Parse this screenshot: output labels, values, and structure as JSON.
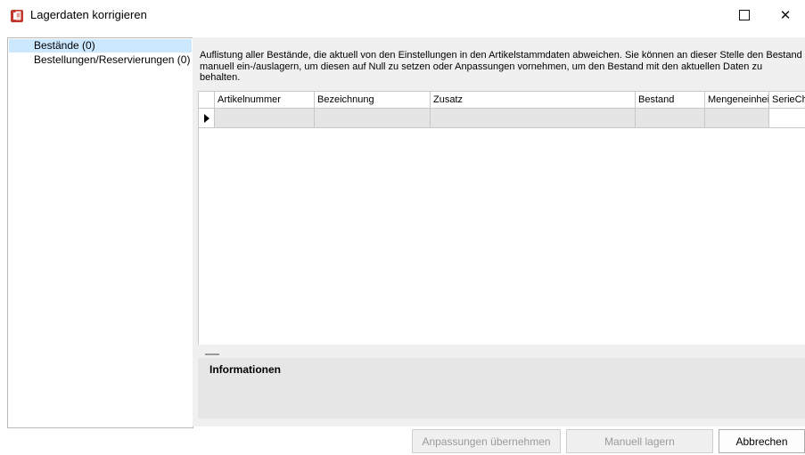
{
  "window": {
    "title": "Lagerdaten korrigieren"
  },
  "sidebar": {
    "items": [
      {
        "label": "Bestände (0)",
        "selected": true
      },
      {
        "label": "Bestellungen/Reservierungen (0)",
        "selected": false
      }
    ]
  },
  "content": {
    "description": "Auflistung aller Bestände, die aktuell von den Einstellungen in den Artikelstammdaten abweichen. Sie können an dieser Stelle den Bestand manuell ein-/auslagern, um diesen auf Null zu setzen oder Anpassungen vornehmen, um den Bestand mit den aktuellen Daten zu behalten."
  },
  "grid": {
    "columns": [
      "Artikelnummer",
      "Bezeichnung",
      "Zusatz",
      "Bestand",
      "Mengeneinheit",
      "SerieCh"
    ],
    "rows": [
      [
        "",
        "",
        "",
        "",
        "",
        ""
      ]
    ]
  },
  "info": {
    "title": "Informationen"
  },
  "buttons": {
    "apply": "Anpassungen übernehmen",
    "manual": "Manuell lagern",
    "cancel": "Abbrechen"
  },
  "colors": {
    "selection": "#cce8ff",
    "panel": "#f0f0f0"
  },
  "icons": {
    "app": "document-stack-icon",
    "maximize": "maximize-icon",
    "close": "close-icon",
    "row": "row-pointer-icon"
  }
}
